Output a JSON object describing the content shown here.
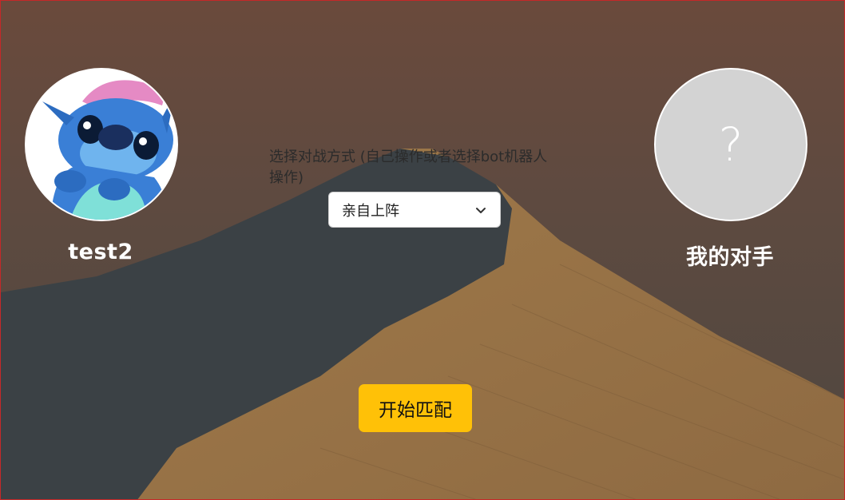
{
  "left_player": {
    "name": "test2",
    "avatar": "stitch-cartoon-avatar"
  },
  "right_player": {
    "name": "我的对手",
    "placeholder_glyph": "?"
  },
  "mode_select": {
    "label": "选择对战方式 (自己操作或者选择bot机器人操作)",
    "selected_value": "亲自上阵",
    "icon": "chevron-down-icon"
  },
  "start_button": {
    "label": "开始匹配",
    "color": "#ffc107"
  },
  "colors": {
    "background_sky": "#5e4a40",
    "dune_shadow": "#3b4145",
    "dune_sand": "#9a7448",
    "accent_border": "#c62828"
  }
}
